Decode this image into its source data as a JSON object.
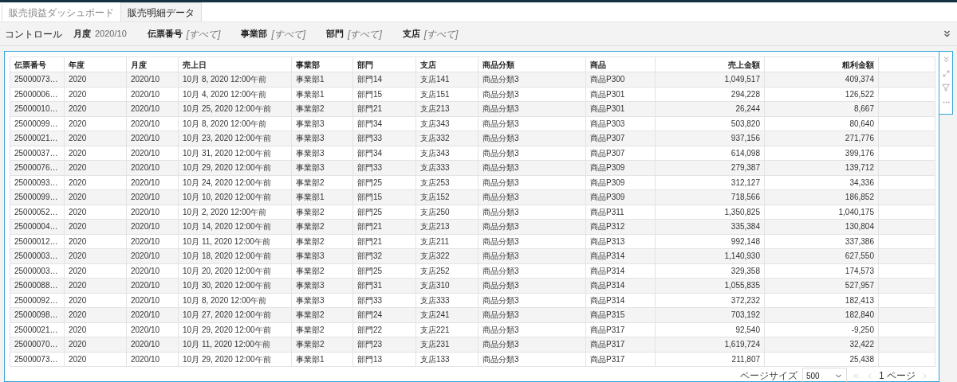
{
  "tabs": [
    {
      "label": "販売損益ダッシュボード",
      "selected": false
    },
    {
      "label": "販売明細データ",
      "selected": true
    }
  ],
  "controls": {
    "title": "コントロール",
    "filters": [
      {
        "label": "月度",
        "value": "2020/10",
        "kind": "value"
      },
      {
        "label": "伝票番号",
        "value": "[すべて]",
        "kind": "all"
      },
      {
        "label": "事業部",
        "value": "[すべて]",
        "kind": "all"
      },
      {
        "label": "部門",
        "value": "[すべて]",
        "kind": "all"
      },
      {
        "label": "支店",
        "value": "[すべて]",
        "kind": "all"
      }
    ]
  },
  "table": {
    "columns": [
      "伝票番号",
      "年度",
      "月度",
      "売上日",
      "事業部",
      "部門",
      "支店",
      "商品分類",
      "商品",
      "売上金額",
      "粗利金額"
    ],
    "rows": [
      [
        "25000073…",
        "2020",
        "2020/10",
        "10月 8, 2020 12:00午前",
        "事業部1",
        "部門14",
        "支店141",
        "商品分類3",
        "商品P300",
        "1,049,517",
        "409,374"
      ],
      [
        "25000006…",
        "2020",
        "2020/10",
        "10月 4, 2020 12:00午前",
        "事業部1",
        "部門15",
        "支店151",
        "商品分類3",
        "商品P301",
        "294,228",
        "126,522"
      ],
      [
        "25000010…",
        "2020",
        "2020/10",
        "10月 25, 2020 12:00午前",
        "事業部2",
        "部門21",
        "支店213",
        "商品分類3",
        "商品P301",
        "26,244",
        "8,667"
      ],
      [
        "25000099…",
        "2020",
        "2020/10",
        "10月 8, 2020 12:00午前",
        "事業部3",
        "部門34",
        "支店343",
        "商品分類3",
        "商品P303",
        "503,820",
        "80,640"
      ],
      [
        "25000021…",
        "2020",
        "2020/10",
        "10月 23, 2020 12:00午前",
        "事業部3",
        "部門33",
        "支店332",
        "商品分類3",
        "商品P307",
        "937,156",
        "271,776"
      ],
      [
        "25000037…",
        "2020",
        "2020/10",
        "10月 31, 2020 12:00午前",
        "事業部3",
        "部門34",
        "支店343",
        "商品分類3",
        "商品P307",
        "614,098",
        "399,176"
      ],
      [
        "25000076…",
        "2020",
        "2020/10",
        "10月 29, 2020 12:00午前",
        "事業部3",
        "部門33",
        "支店333",
        "商品分類3",
        "商品P309",
        "279,387",
        "139,712"
      ],
      [
        "25000093…",
        "2020",
        "2020/10",
        "10月 24, 2020 12:00午前",
        "事業部2",
        "部門25",
        "支店253",
        "商品分類3",
        "商品P309",
        "312,127",
        "34,336"
      ],
      [
        "25000099…",
        "2020",
        "2020/10",
        "10月 10, 2020 12:00午前",
        "事業部1",
        "部門15",
        "支店152",
        "商品分類3",
        "商品P309",
        "718,566",
        "186,852"
      ],
      [
        "25000052…",
        "2020",
        "2020/10",
        "10月 2, 2020 12:00午前",
        "事業部2",
        "部門25",
        "支店250",
        "商品分類3",
        "商品P311",
        "1,350,825",
        "1,040,175"
      ],
      [
        "25000004…",
        "2020",
        "2020/10",
        "10月 14, 2020 12:00午前",
        "事業部2",
        "部門21",
        "支店213",
        "商品分類3",
        "商品P312",
        "335,384",
        "130,804"
      ],
      [
        "25000012…",
        "2020",
        "2020/10",
        "10月 11, 2020 12:00午前",
        "事業部2",
        "部門21",
        "支店211",
        "商品分類3",
        "商品P313",
        "992,148",
        "337,386"
      ],
      [
        "25000003…",
        "2020",
        "2020/10",
        "10月 18, 2020 12:00午前",
        "事業部3",
        "部門32",
        "支店322",
        "商品分類3",
        "商品P314",
        "1,140,930",
        "627,550"
      ],
      [
        "25000003…",
        "2020",
        "2020/10",
        "10月 20, 2020 12:00午前",
        "事業部2",
        "部門25",
        "支店252",
        "商品分類3",
        "商品P314",
        "329,358",
        "174,573"
      ],
      [
        "25000088…",
        "2020",
        "2020/10",
        "10月 30, 2020 12:00午前",
        "事業部3",
        "部門31",
        "支店310",
        "商品分類3",
        "商品P314",
        "1,055,835",
        "527,957"
      ],
      [
        "25000092…",
        "2020",
        "2020/10",
        "10月 8, 2020 12:00午前",
        "事業部3",
        "部門33",
        "支店333",
        "商品分類3",
        "商品P314",
        "372,232",
        "182,413"
      ],
      [
        "25000098…",
        "2020",
        "2020/10",
        "10月 27, 2020 12:00午前",
        "事業部2",
        "部門24",
        "支店241",
        "商品分類3",
        "商品P315",
        "703,192",
        "182,840"
      ],
      [
        "25000021…",
        "2020",
        "2020/10",
        "10月 29, 2020 12:00午前",
        "事業部2",
        "部門22",
        "支店221",
        "商品分類3",
        "商品P317",
        "92,540",
        "-9,250"
      ],
      [
        "25000070…",
        "2020",
        "2020/10",
        "10月 11, 2020 12:00午前",
        "事業部2",
        "部門23",
        "支店231",
        "商品分類3",
        "商品P317",
        "1,619,724",
        "32,422"
      ],
      [
        "25000073…",
        "2020",
        "2020/10",
        "10月 29, 2020 12:00午前",
        "事業部1",
        "部門13",
        "支店133",
        "商品分類3",
        "商品P317",
        "211,807",
        "25,438"
      ]
    ]
  },
  "pagination": {
    "page_size_label": "ページサイズ",
    "page_size": "500",
    "page": "1 ページ"
  }
}
